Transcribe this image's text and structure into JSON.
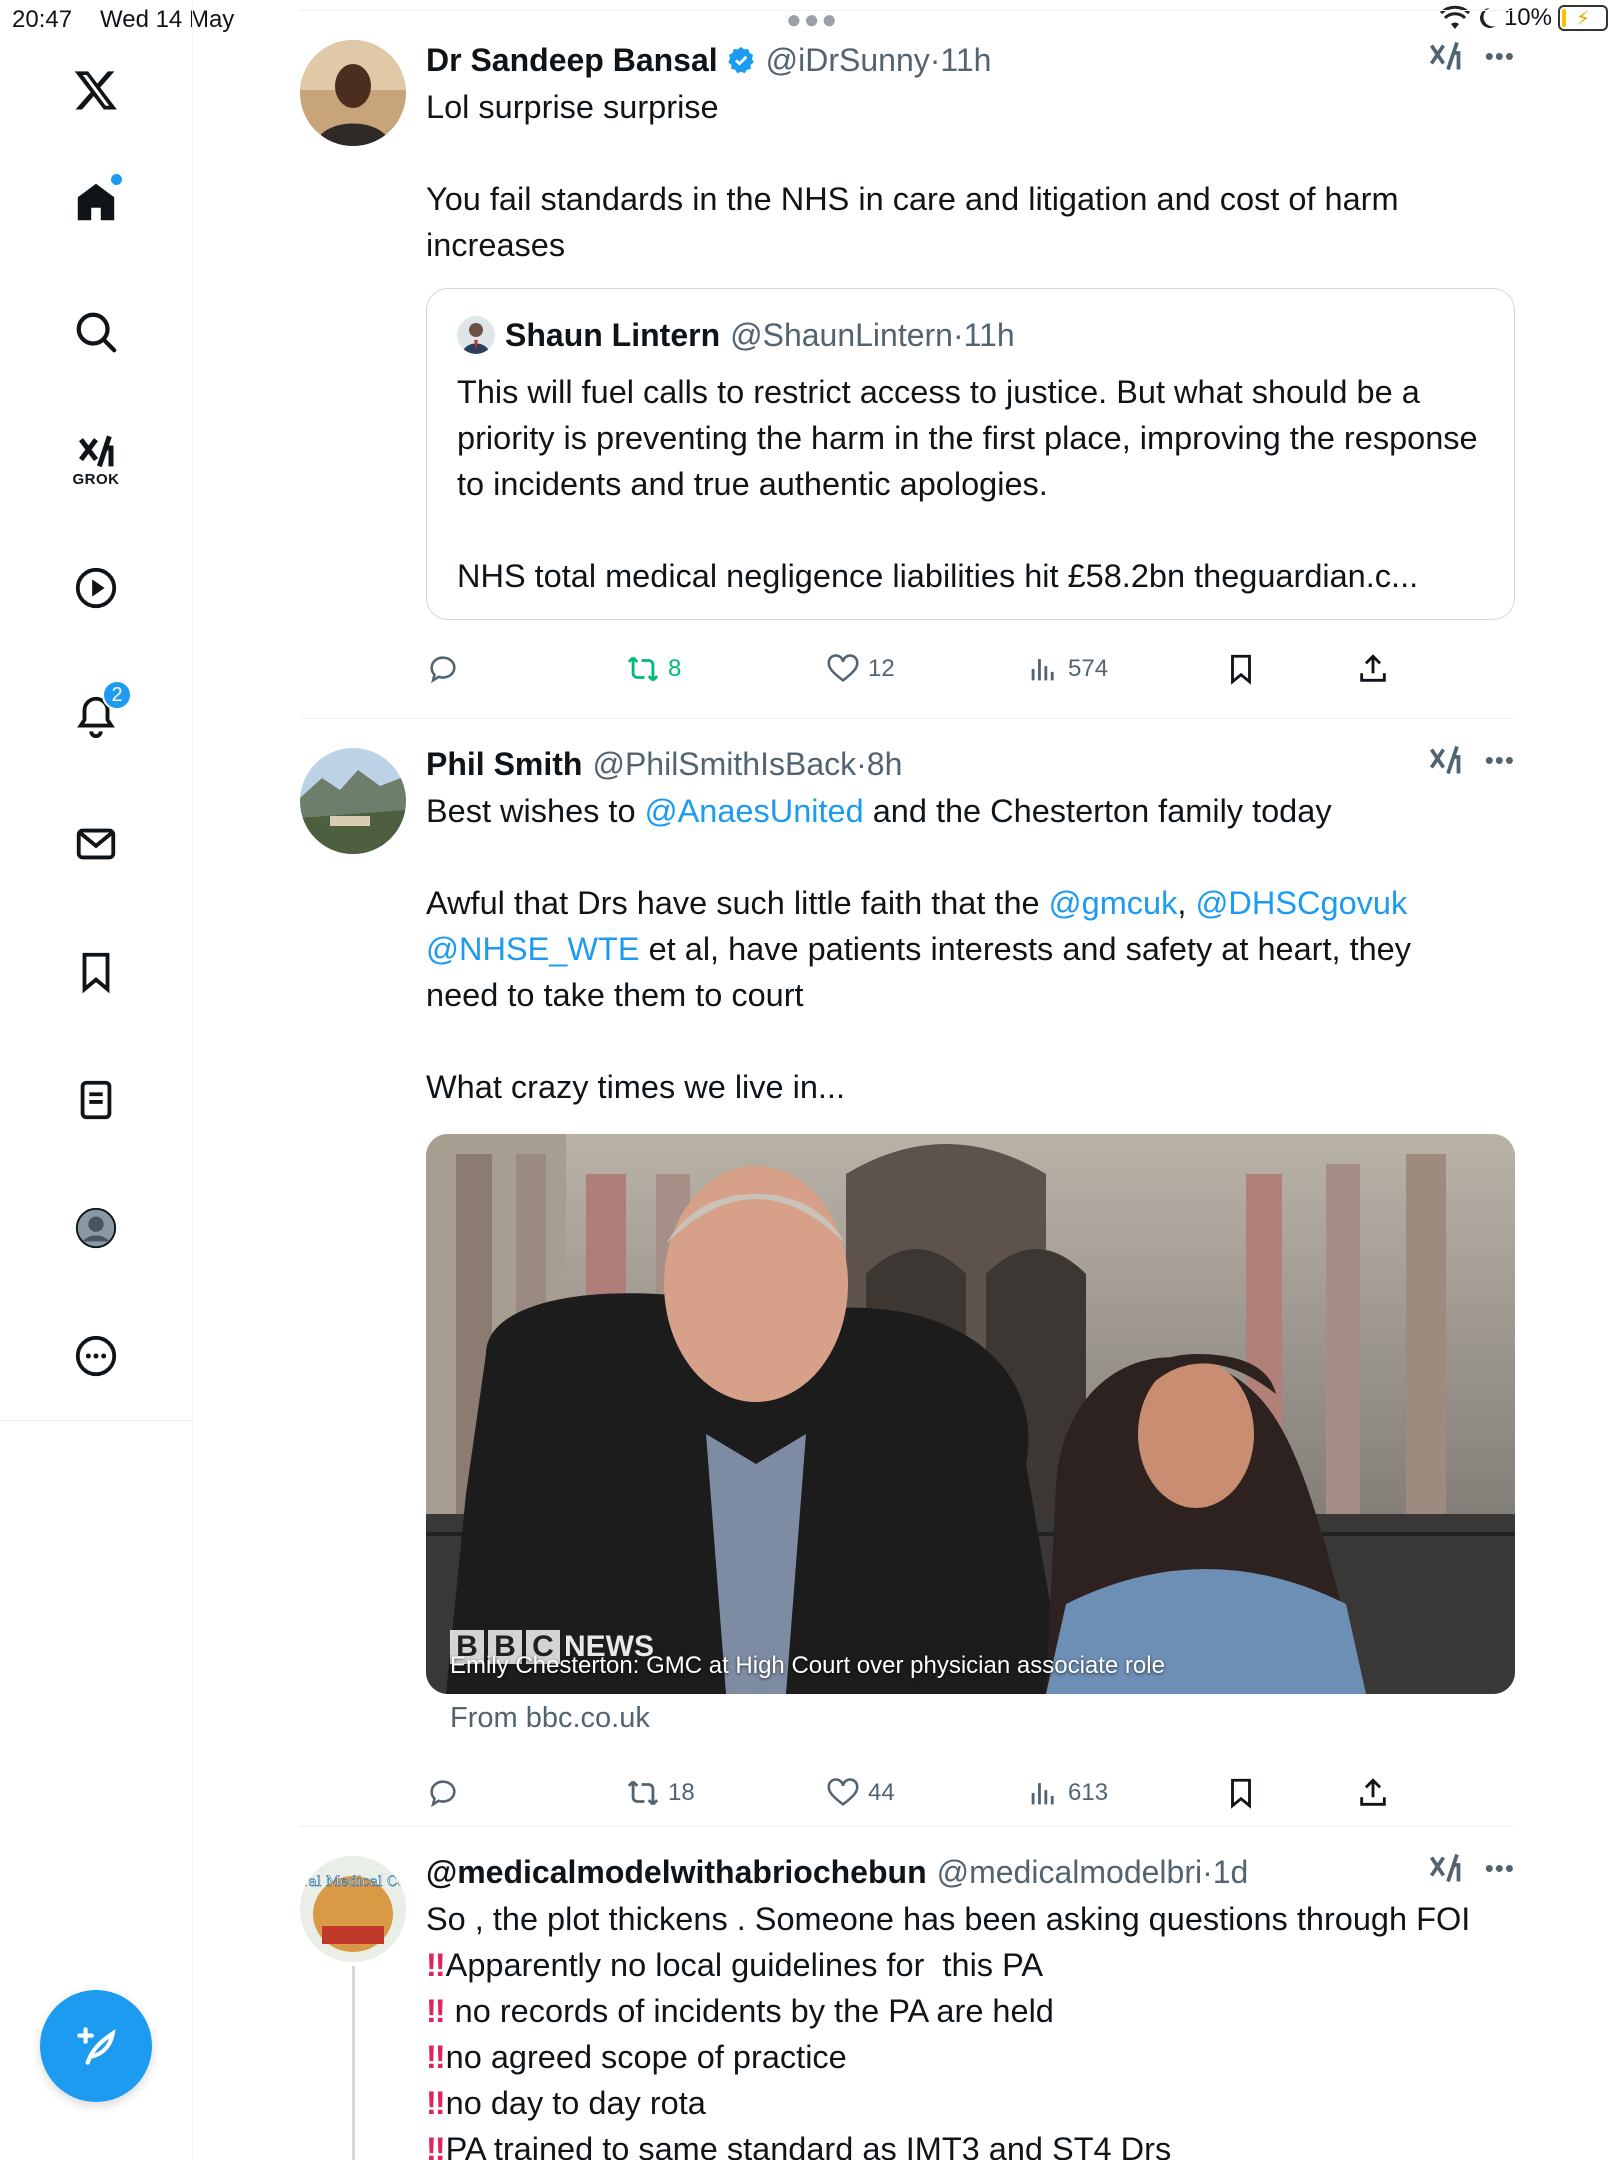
{
  "status_bar": {
    "time": "20:47",
    "date": "Wed 14 May",
    "battery": "10%"
  },
  "sidebar": {
    "items": [
      {
        "name": "x-logo",
        "label": ""
      },
      {
        "name": "home",
        "label": "",
        "has_dot": true
      },
      {
        "name": "search",
        "label": ""
      },
      {
        "name": "grok",
        "label": "GROK"
      },
      {
        "name": "video",
        "label": ""
      },
      {
        "name": "notifications",
        "label": "",
        "badge": "2"
      },
      {
        "name": "messages",
        "label": ""
      },
      {
        "name": "bookmarks",
        "label": ""
      },
      {
        "name": "lists",
        "label": ""
      },
      {
        "name": "profile",
        "label": ""
      },
      {
        "name": "more",
        "label": ""
      }
    ]
  },
  "tweets": [
    {
      "display_name": "Dr Sandeep Bansal",
      "handle": "@iDrSunny",
      "time": "11h",
      "verified": true,
      "text_1": "Lol surprise surprise",
      "text_2": "You fail standards in the NHS in care and litigation and cost of harm increases",
      "quote": {
        "display_name": "Shaun Lintern",
        "handle": "@ShaunLintern",
        "time": "11h",
        "text_1": "This will fuel calls to restrict access to justice. But what should be a priority is preventing the harm in the first place, improving the response to incidents and true authentic apologies.",
        "text_2": "NHS total medical negligence liabilities hit £58.2bn theguardian.c..."
      },
      "reposts": "8",
      "likes": "12",
      "views": "574"
    },
    {
      "display_name": "Phil Smith",
      "handle": "@PhilSmithIsBack",
      "time": "8h",
      "line_1_pre": "Best wishes to ",
      "line_1_mention": "@AnaesUnited",
      "line_1_post": " and the Chesterton family today",
      "line_2_pre": "Awful that Drs have such little faith that the ",
      "mention_2": "@gmcuk",
      "mention_3": "@DHSCgovuk",
      "mention_4": "@NHSE_WTE",
      "line_2_post": " et al, have patients interests and safety at heart, they need to take them to court",
      "line_3": "What crazy times we live in...",
      "media_caption": "Emily Chesterton: GMC at High Court over physician associate role",
      "media_logo": "NEWS",
      "link_domain": "From bbc.co.uk",
      "reposts": "18",
      "likes": "44",
      "views": "613"
    },
    {
      "display_name": "@medicalmodelwithabriochebun",
      "handle": "@medicalmodelbri",
      "time": "1d",
      "avatar_text": "General Medical Council",
      "intro": "So , the plot thickens . Someone has been asking questions through FOI",
      "bullets": [
        "Apparently no local guidelines for  this PA",
        " no records of incidents by the PA are held",
        "no agreed scope of practice",
        "no day to day rota",
        "PA trained to same standard as IMT3 and ST4 Drs"
      ]
    }
  ],
  "colors": {
    "accent": "#1d9bf0",
    "repost_active": "#00ba7c",
    "secondary_text": "#536471",
    "warning": "#e0245e"
  }
}
